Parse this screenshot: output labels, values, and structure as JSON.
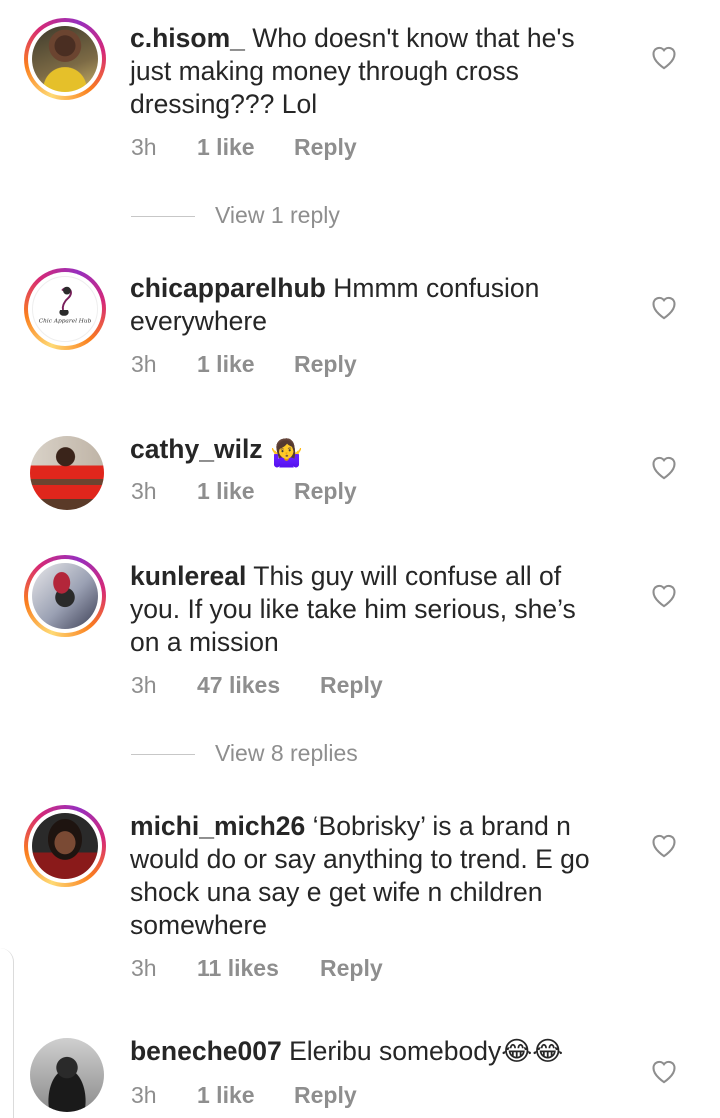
{
  "comments": [
    {
      "username": "c.hisom_",
      "text": "Who doesn't know that he's just making money through cross dressing??? Lol",
      "time": "3h",
      "likes": "1 like",
      "reply_label": "Reply",
      "view_replies": "View 1 reply"
    },
    {
      "username": "chicapparelhub",
      "text": "Hmmm confusion everywhere",
      "time": "3h",
      "likes": "1 like",
      "reply_label": "Reply",
      "avatar_text": "Chic Apparel Hub"
    },
    {
      "username": "cathy_wilz",
      "text": "🤷‍♀️",
      "time": "3h",
      "likes": "1 like",
      "reply_label": "Reply"
    },
    {
      "username": "kunlereal",
      "text": "This guy will confuse all of you. If you like take him serious, she’s on a mission",
      "time": "3h",
      "likes": "47 likes",
      "reply_label": "Reply",
      "view_replies": "View 8 replies"
    },
    {
      "username": "michi_mich26",
      "text": "‘Bobrisky’ is a brand n would do or say anything to trend. E go shock una say e get wife n children somewhere",
      "time": "3h",
      "likes": "11 likes",
      "reply_label": "Reply"
    },
    {
      "username": "beneche007",
      "text": "Eleribu somebody😂😂",
      "time": "3h",
      "likes": "1 like",
      "reply_label": "Reply"
    }
  ],
  "icons": {
    "like": "heart-outline-icon"
  },
  "colors": {
    "text": "#262626",
    "meta": "#8e8e8e",
    "divider": "#c7c7c7"
  }
}
